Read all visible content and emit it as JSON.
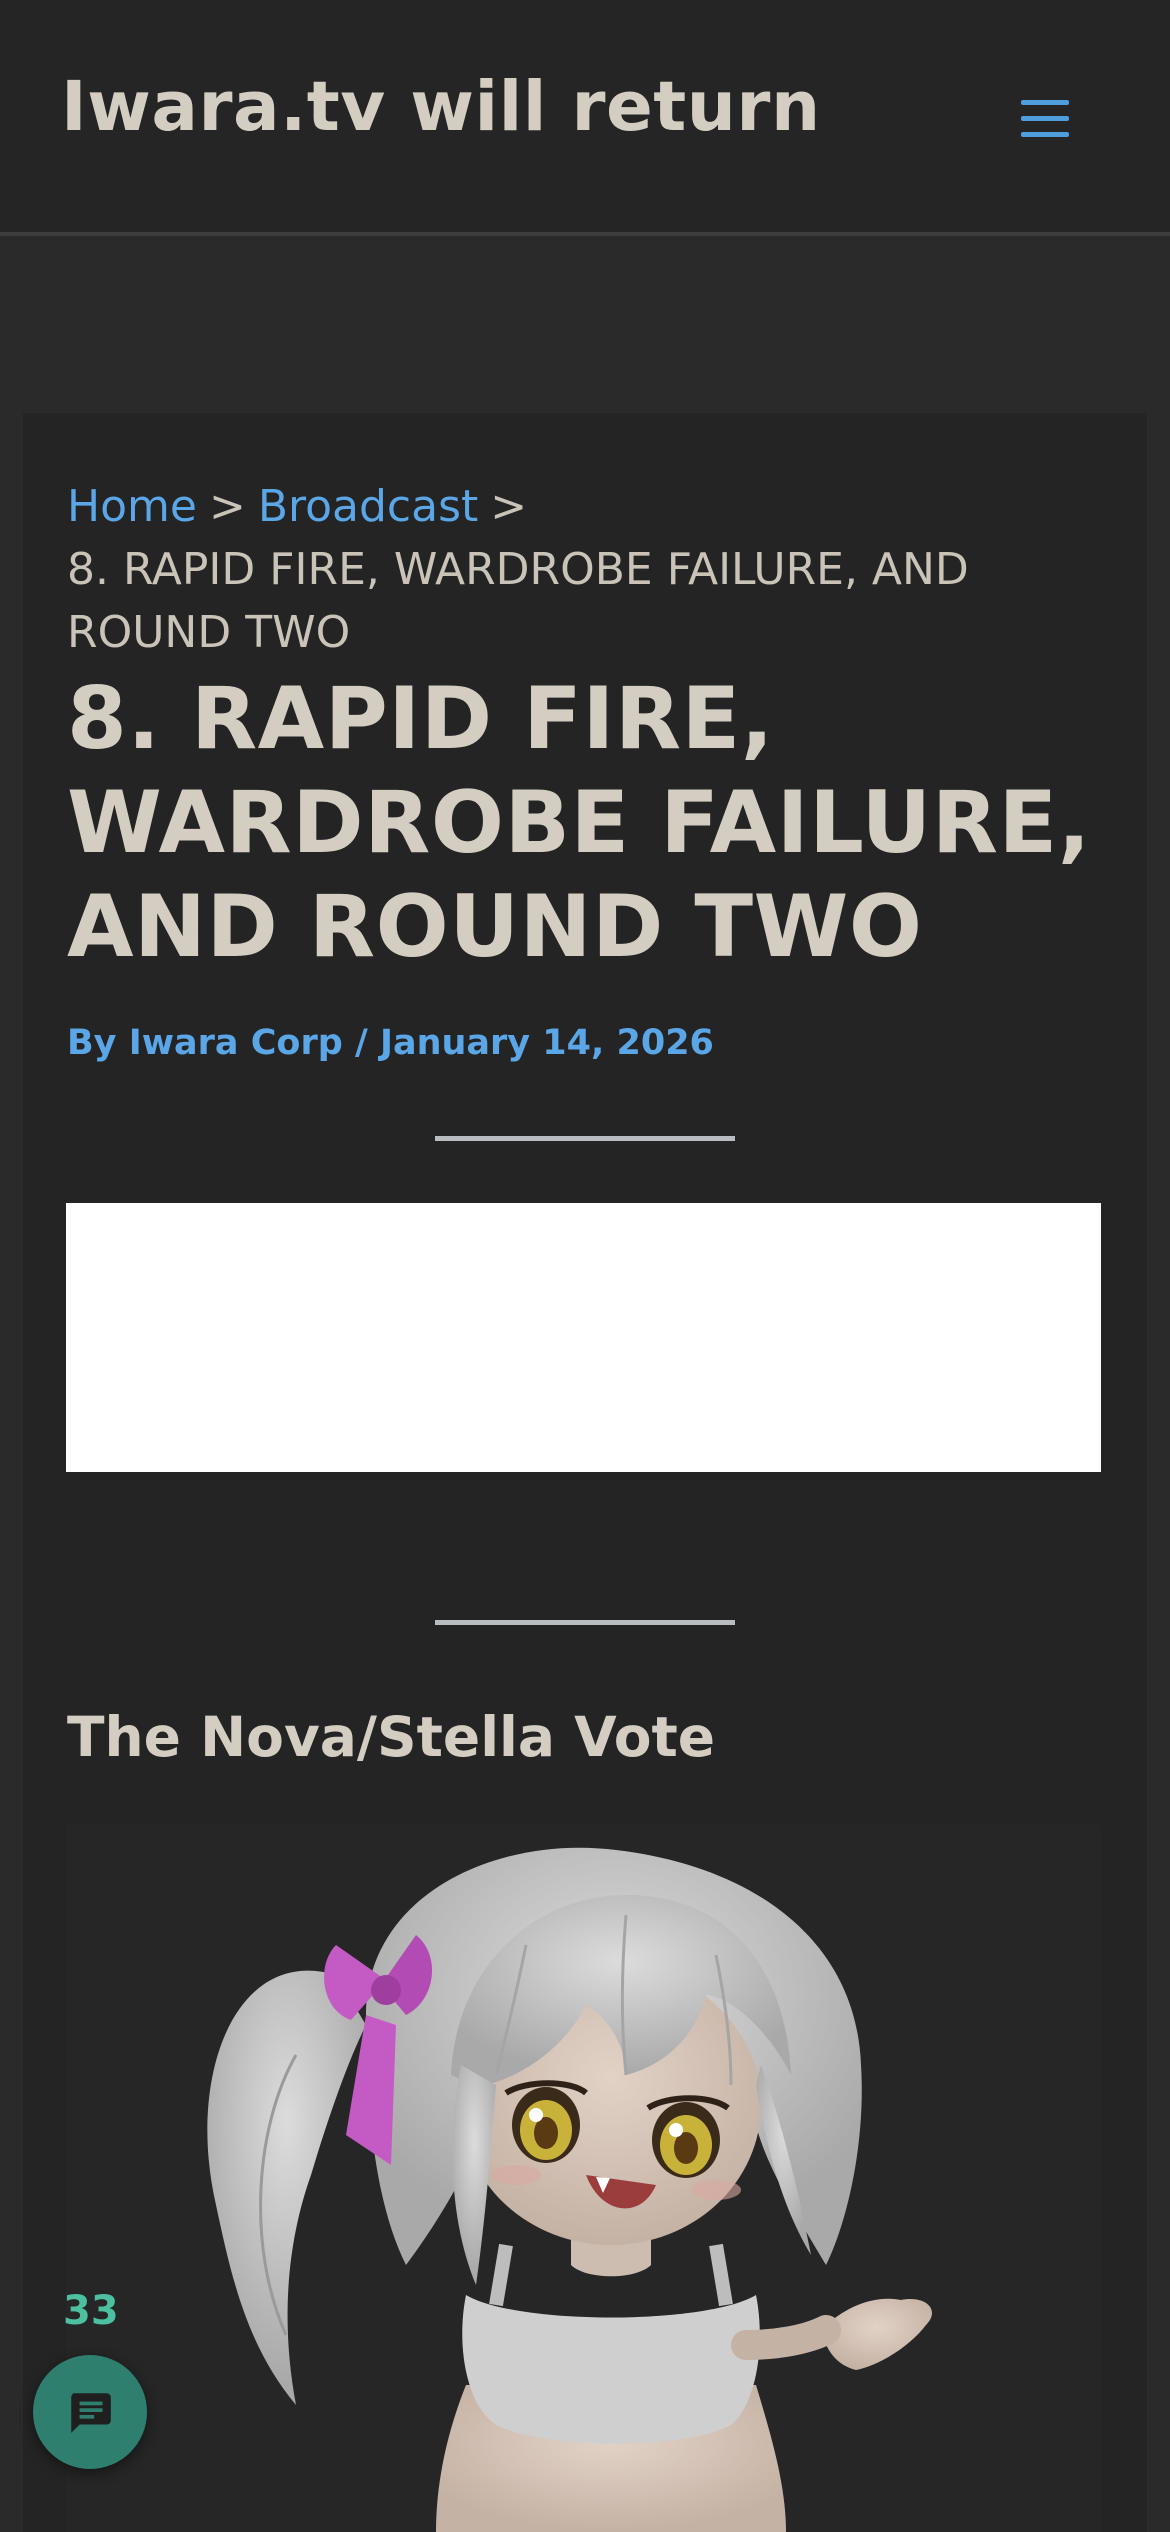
{
  "header": {
    "site_title": "Iwara.tv will return",
    "menu_icon": "hamburger-menu-icon"
  },
  "breadcrumb": {
    "items": [
      "Home",
      "Broadcast"
    ],
    "separator": ">",
    "current": "8. RAPID FIRE, WARDROBE FAILURE, AND ROUND TWO"
  },
  "article": {
    "title": "8. RAPID FIRE, WARDROBE FAILURE, AND ROUND TWO",
    "author_prefix": "By",
    "author": "Iwara Corp",
    "byline_separator": "/",
    "date": "January 14, 2026",
    "section_heading": "The Nova/Stella Vote"
  },
  "comments": {
    "count": "33",
    "icon": "chat-bubble-icon"
  },
  "colors": {
    "background": "#2a2a2a",
    "card": "#242424",
    "link": "#5aa6e6",
    "heading": "#d4cdc2",
    "comment_accent": "#2e7f6e"
  }
}
